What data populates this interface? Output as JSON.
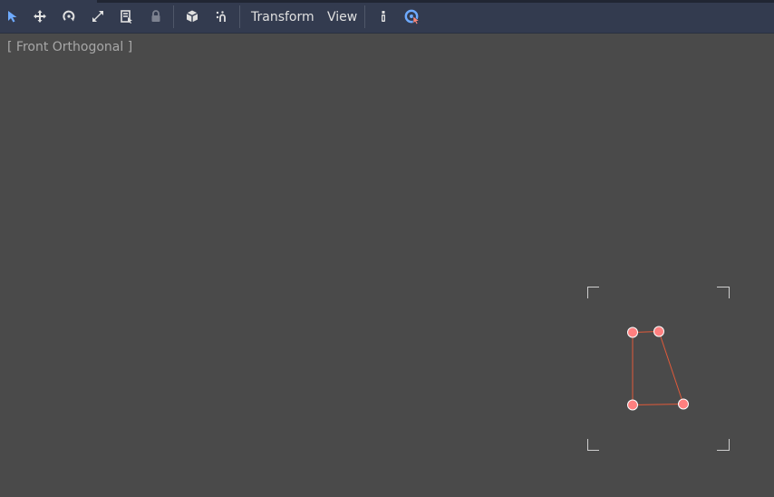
{
  "toolbar": {
    "tools": [
      {
        "name": "select-mode",
        "icon": "select-arrow-icon",
        "active": true
      },
      {
        "name": "move-mode",
        "icon": "move-arrows-icon"
      },
      {
        "name": "rotate-mode",
        "icon": "rotate-icon"
      },
      {
        "name": "scale-mode",
        "icon": "scale-arrows-icon"
      },
      {
        "name": "list-select",
        "icon": "list-select-icon"
      },
      {
        "name": "lock",
        "icon": "lock-icon",
        "disabled": true
      },
      {
        "name": "use-local-space",
        "icon": "cube-icon"
      },
      {
        "name": "use-snap",
        "icon": "snap-icon"
      }
    ],
    "menus": {
      "transform": "Transform",
      "view": "View"
    },
    "extra_tools": [
      {
        "name": "visibility-aabb",
        "icon": "pin-icon"
      },
      {
        "name": "polygon-edit",
        "icon": "polygon-edit-icon"
      }
    ],
    "colors": {
      "background": "#333b4f",
      "icon": "#e0e0e0",
      "accent": "#6eaaff",
      "disabled": "#7d8290"
    }
  },
  "viewport": {
    "label": "[ Front Orthogonal ]",
    "background": "#4a4a4a",
    "polygon_color": "#e05a3a",
    "handle_color": "#ff7f7f",
    "selection_bracket_color": "#cfcfcf",
    "polygon_vertex_count": 4
  }
}
